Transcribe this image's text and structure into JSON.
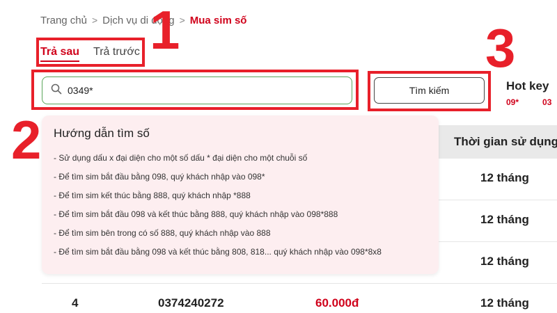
{
  "breadcrumb": {
    "home": "Trang chủ",
    "services": "Dịch vụ di động",
    "current": "Mua sim số",
    "separator": ">"
  },
  "tabs": [
    {
      "label": "Trả sau",
      "active": true
    },
    {
      "label": "Trả trước",
      "active": false
    }
  ],
  "search": {
    "value": "0349*",
    "placeholder": ""
  },
  "search_button": "Tìm kiếm",
  "hotkey": {
    "title": "Hot key",
    "items": [
      "09*",
      "03"
    ]
  },
  "table": {
    "header_time": "Thời gian sử dụng",
    "rows": [
      {
        "index": "",
        "number": "",
        "price": "",
        "duration": "12 tháng"
      },
      {
        "index": "",
        "number": "",
        "price": "",
        "duration": "12 tháng"
      },
      {
        "index": "",
        "number": "",
        "price": "",
        "duration": "12 tháng"
      },
      {
        "index": "4",
        "number": "0374240272",
        "price": "60.000đ",
        "duration": "12 tháng"
      }
    ]
  },
  "guide": {
    "title": "Hướng dẫn tìm số",
    "items": [
      "- Sử dụng dấu x đại diện cho một số dấu * đại diện cho một chuỗi số",
      "- Để tìm sim bắt đầu bằng 098, quý khách nhập vào 098*",
      "- Để tìm sim kết thúc bằng 888, quý khách nhập *888",
      "- Để tìm sim bắt đầu 098 và kết thúc bằng 888, quý khách nhập vào 098*888",
      "- Để tìm sim bên trong có số 888, quý khách nhập vào 888",
      "- Để tìm sim bắt đầu bằng 098 và kết thúc bằng 808, 818... quý khách nhập vào 098*8x8"
    ]
  },
  "annotations": {
    "label_1": "1",
    "label_2": "2",
    "label_3": "3",
    "color": "#e8202a"
  },
  "colors": {
    "accent": "#d0021b",
    "search_border": "#5aa55a",
    "guide_bg": "#fdeef0",
    "table_header_bg": "#e9e9e9"
  },
  "icons": {
    "search": "search-icon"
  }
}
